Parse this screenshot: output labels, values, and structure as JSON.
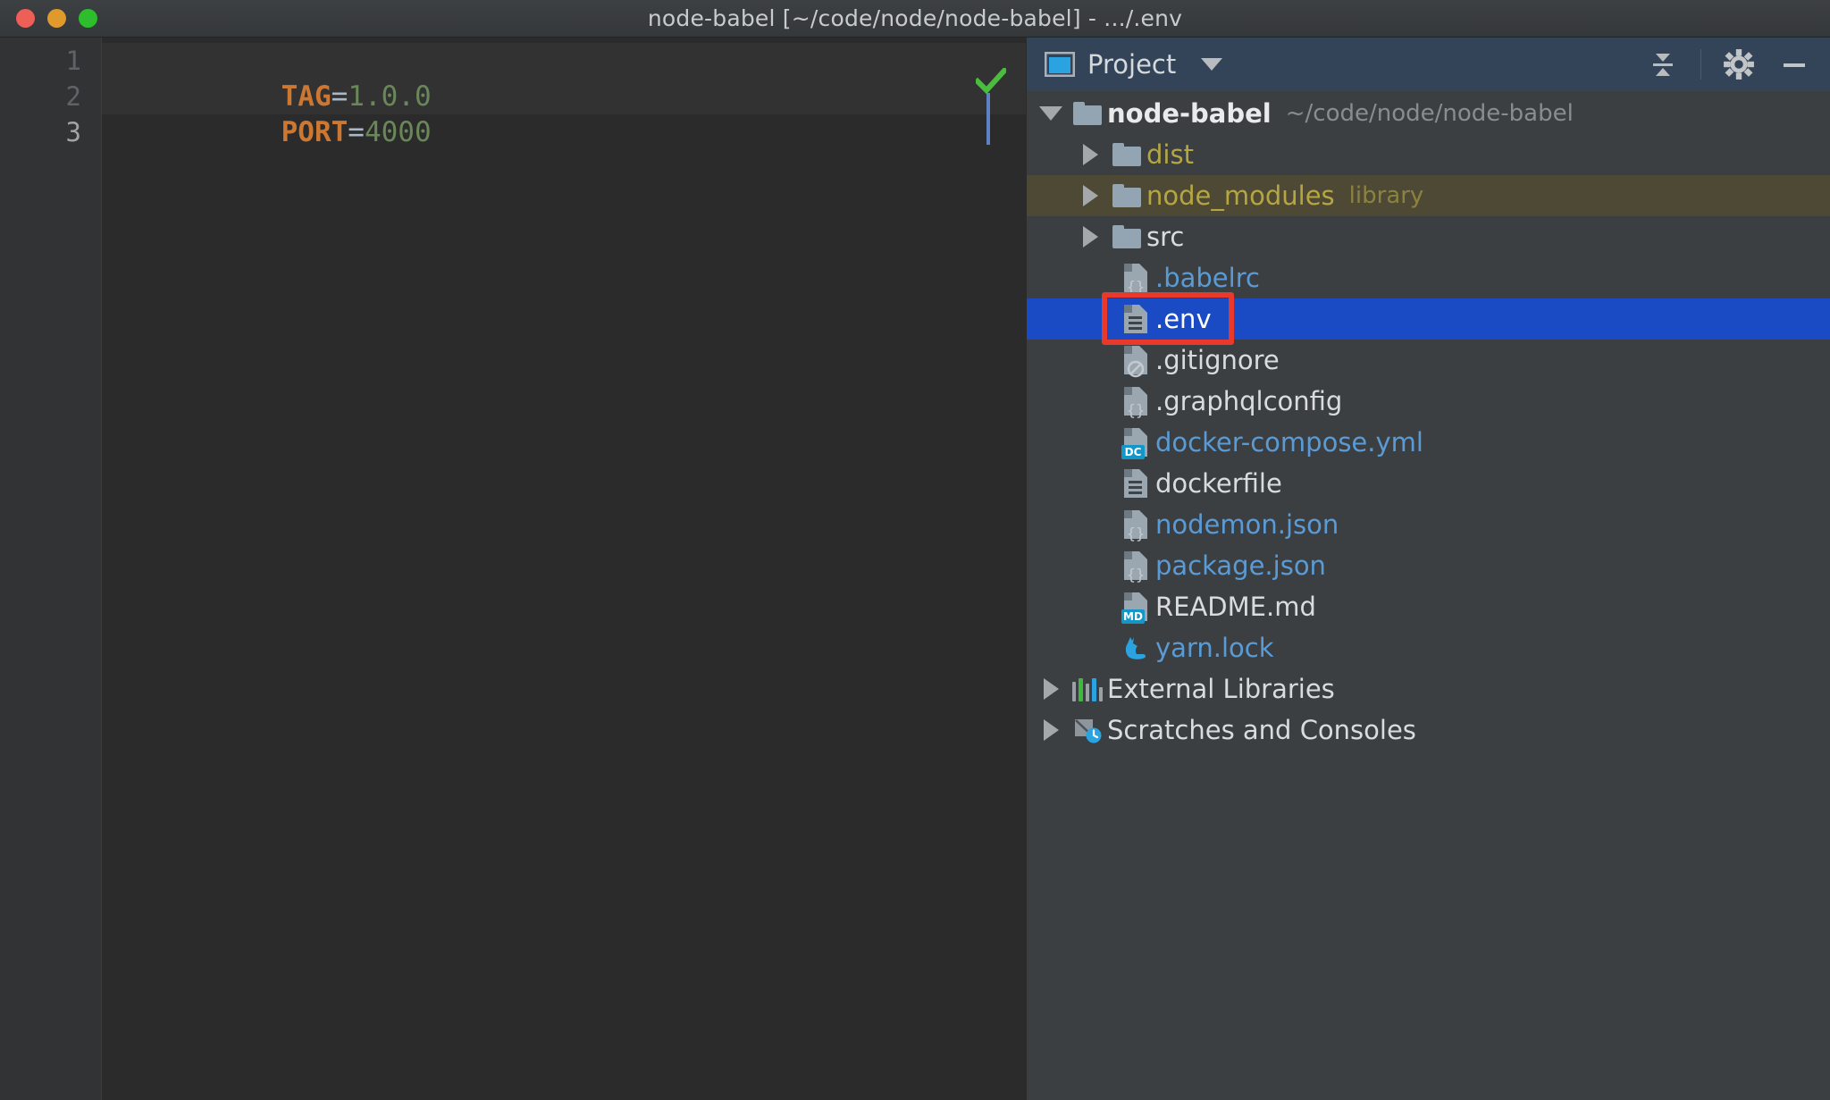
{
  "window": {
    "title": "node-babel [~/code/node/node-babel] - .../.env",
    "traffic_lights": [
      {
        "name": "close",
        "color": "#ed5f57"
      },
      {
        "name": "minimize",
        "color": "#e09a2c"
      },
      {
        "name": "zoom",
        "color": "#2dbd2d"
      }
    ]
  },
  "editor": {
    "gutter_numbers": [
      "1",
      "2",
      "3"
    ],
    "lines": [
      {
        "key": "TAG",
        "eq": "=",
        "value": "1.0.0"
      },
      {
        "key": "PORT",
        "eq": "=",
        "value": "4000"
      },
      {
        "key": "",
        "eq": "",
        "value": ""
      }
    ],
    "inspection_status": "ok-check",
    "colors": {
      "key": "#cc7832",
      "value": "#6a8759",
      "operator": "#a9b7c6",
      "background": "#2b2b2b",
      "gutter_background": "#313335",
      "caret": "#5c82c4",
      "inspection_ok": "#4bbd3e"
    }
  },
  "project_panel": {
    "header": {
      "icon": "project-icon",
      "label": "Project",
      "dropdown_icon": "chevron-down-icon",
      "collapse_all_icon": "collapse-all-icon",
      "settings_icon": "gear-icon",
      "hide_icon": "minimize-icon"
    },
    "tree": [
      {
        "name": "node-babel",
        "meta": "~/code/node/node-babel",
        "type": "folder",
        "icon": "folder-icon",
        "arrow": "open",
        "depth": 0,
        "style": "bold",
        "row": "normal"
      },
      {
        "name": "dist",
        "meta": "",
        "type": "folder",
        "icon": "folder-icon",
        "arrow": "closed",
        "depth": 1,
        "style": "olive",
        "row": "normal"
      },
      {
        "name": "node_modules",
        "meta": "library",
        "type": "folder",
        "icon": "folder-icon",
        "arrow": "closed",
        "depth": 1,
        "style": "olive",
        "row": "olive"
      },
      {
        "name": "src",
        "meta": "",
        "type": "folder",
        "icon": "folder-icon",
        "arrow": "closed",
        "depth": 1,
        "style": "white",
        "row": "normal"
      },
      {
        "name": ".babelrc",
        "meta": "",
        "type": "file",
        "icon": "file-json-icon",
        "arrow": "none",
        "depth": 2,
        "style": "blue",
        "row": "normal"
      },
      {
        "name": ".env",
        "meta": "",
        "type": "file",
        "icon": "file-text-icon",
        "arrow": "none",
        "depth": 2,
        "style": "selected",
        "row": "selected"
      },
      {
        "name": ".gitignore",
        "meta": "",
        "type": "file",
        "icon": "file-ignore-icon",
        "arrow": "none",
        "depth": 2,
        "style": "white",
        "row": "normal"
      },
      {
        "name": ".graphqlconfig",
        "meta": "",
        "type": "file",
        "icon": "file-json-icon",
        "arrow": "none",
        "depth": 2,
        "style": "white",
        "row": "normal"
      },
      {
        "name": "docker-compose.yml",
        "meta": "",
        "type": "file",
        "icon": "file-dc-icon",
        "arrow": "none",
        "depth": 2,
        "style": "blue",
        "row": "normal"
      },
      {
        "name": "dockerfile",
        "meta": "",
        "type": "file",
        "icon": "file-text-icon",
        "arrow": "none",
        "depth": 2,
        "style": "white",
        "row": "normal"
      },
      {
        "name": "nodemon.json",
        "meta": "",
        "type": "file",
        "icon": "file-json-icon",
        "arrow": "none",
        "depth": 2,
        "style": "blue",
        "row": "normal"
      },
      {
        "name": "package.json",
        "meta": "",
        "type": "file",
        "icon": "file-json-icon",
        "arrow": "none",
        "depth": 2,
        "style": "blue",
        "row": "normal"
      },
      {
        "name": "README.md",
        "meta": "",
        "type": "file",
        "icon": "file-md-icon",
        "arrow": "none",
        "depth": 2,
        "style": "white",
        "row": "normal"
      },
      {
        "name": "yarn.lock",
        "meta": "",
        "type": "file",
        "icon": "yarn-cat-icon",
        "arrow": "none",
        "depth": 2,
        "style": "blue",
        "row": "normal"
      },
      {
        "name": "External Libraries",
        "meta": "",
        "type": "node",
        "icon": "external-libraries-icon",
        "arrow": "closed",
        "depth": 0,
        "style": "white",
        "row": "normal"
      },
      {
        "name": "Scratches and Consoles",
        "meta": "",
        "type": "node",
        "icon": "scratches-icon",
        "arrow": "closed",
        "depth": 0,
        "style": "white",
        "row": "normal"
      }
    ],
    "selected_item": ".env",
    "annotation": {
      "target": ".env",
      "shape": "rectangle",
      "color": "#e8392b"
    },
    "colors": {
      "panel_background": "#3c3f41",
      "header_background": "#334459",
      "selection": "#1a4ac4",
      "olive_row": "#4e4935",
      "blue_text": "#5b9bd5",
      "olive_text": "#b5a642"
    }
  }
}
